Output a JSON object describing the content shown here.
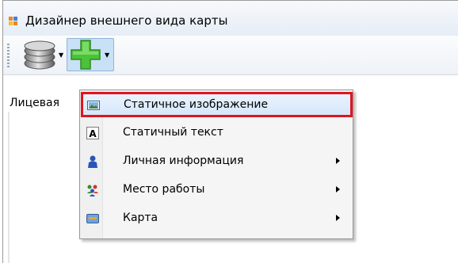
{
  "window": {
    "title": "Дизайнер внешнего вида карты"
  },
  "toolbar": {
    "database_icon": "database-icon",
    "add_icon": "green-plus-icon"
  },
  "tab": {
    "label": "Лицевая"
  },
  "menu": {
    "items": [
      {
        "label": "Статичное изображение",
        "icon": "picture-icon",
        "submenu": false,
        "highlighted": true
      },
      {
        "label": "Статичный текст",
        "icon": "text-a-icon",
        "submenu": false,
        "highlighted": false
      },
      {
        "label": "Личная информация",
        "icon": "person-icon",
        "submenu": true,
        "highlighted": false
      },
      {
        "label": "Место работы",
        "icon": "people-group-icon",
        "submenu": true,
        "highlighted": false
      },
      {
        "label": "Карта",
        "icon": "card-icon",
        "submenu": true,
        "highlighted": false
      }
    ]
  },
  "colors": {
    "highlight_frame": "#e0141e",
    "selection": "#d5e7fb",
    "add_green": "#4cc13a"
  }
}
